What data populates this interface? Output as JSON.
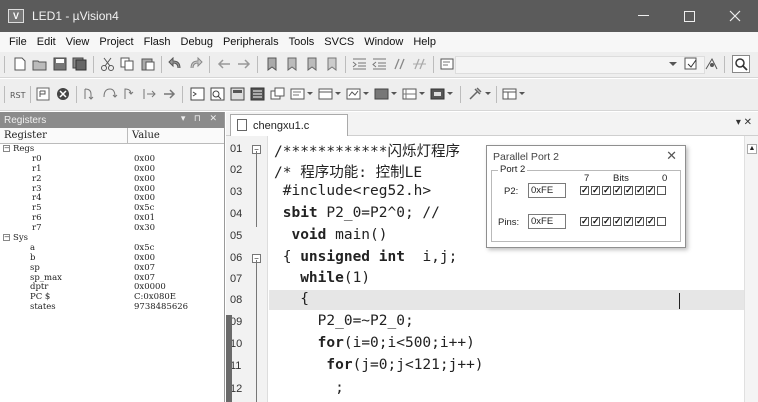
{
  "window": {
    "title": "LED1 - µVision4",
    "icon_letter": "V"
  },
  "menu": [
    "File",
    "Edit",
    "View",
    "Project",
    "Flash",
    "Debug",
    "Peripherals",
    "Tools",
    "SVCS",
    "Window",
    "Help"
  ],
  "registers_panel": {
    "title": "Registers",
    "columns": [
      "Register",
      "Value"
    ],
    "regs_group": "Regs",
    "regs": [
      {
        "name": "r0",
        "value": "0x00"
      },
      {
        "name": "r1",
        "value": "0x00"
      },
      {
        "name": "r2",
        "value": "0x00"
      },
      {
        "name": "r3",
        "value": "0x00"
      },
      {
        "name": "r4",
        "value": "0x00"
      },
      {
        "name": "r5",
        "value": "0x5c"
      },
      {
        "name": "r6",
        "value": "0x01"
      },
      {
        "name": "r7",
        "value": "0x30"
      }
    ],
    "sys_group": "Sys",
    "sys": [
      {
        "name": "a",
        "value": "0x5c"
      },
      {
        "name": "b",
        "value": "0x00"
      },
      {
        "name": "sp",
        "value": "0x07"
      },
      {
        "name": "sp_max",
        "value": "0x07"
      },
      {
        "name": "dptr",
        "value": "0x0000"
      },
      {
        "name": "PC  $",
        "value": "C:0x080E"
      },
      {
        "name": "states",
        "value": "9738485626"
      }
    ]
  },
  "editor": {
    "tab_label": "chengxu1.c",
    "line_numbers": [
      "01",
      "02",
      "03",
      "04",
      "05",
      "06",
      "07",
      "08",
      "09",
      "10",
      "11",
      "12"
    ],
    "lines": [
      "/************闪烁灯程序",
      "/* 程序功能: 控制LE",
      " #include<reg52.h>",
      " sbit P2_0=P2^0; //",
      "  void main()",
      " { unsigned int  i,j;",
      "   while(1)",
      "   {",
      "     P2_0=~P2_0;",
      "     for(i=0;i<500;i++)",
      "      for(j=0;j<121;j++)",
      "       ;"
    ]
  },
  "parallel_port_dialog": {
    "title": "Parallel Port 2",
    "group": "Port 2",
    "bits_label": "Bits",
    "bit_high": "7",
    "bit_low": "0",
    "p2_label": "P2:",
    "p2_value": "0xFE",
    "pins_label": "Pins:",
    "pins_value": "0xFE",
    "p2_bits": [
      true,
      true,
      true,
      true,
      true,
      true,
      true,
      false
    ],
    "pins_bits": [
      true,
      true,
      true,
      true,
      true,
      true,
      true,
      false
    ]
  },
  "colors": {
    "titlebar": "#5b5b5b",
    "panel_header": "#8b8b8b",
    "current_line": "#e6e6e6"
  },
  "icons": [
    "minimize-icon",
    "maximize-icon",
    "close-icon",
    "new-file-icon",
    "open-icon",
    "save-icon",
    "cut-icon",
    "copy-icon",
    "paste-icon",
    "undo-icon",
    "redo-icon",
    "reset-icon",
    "stop-icon",
    "step-icon",
    "checked-icon",
    "unchecked-icon"
  ]
}
